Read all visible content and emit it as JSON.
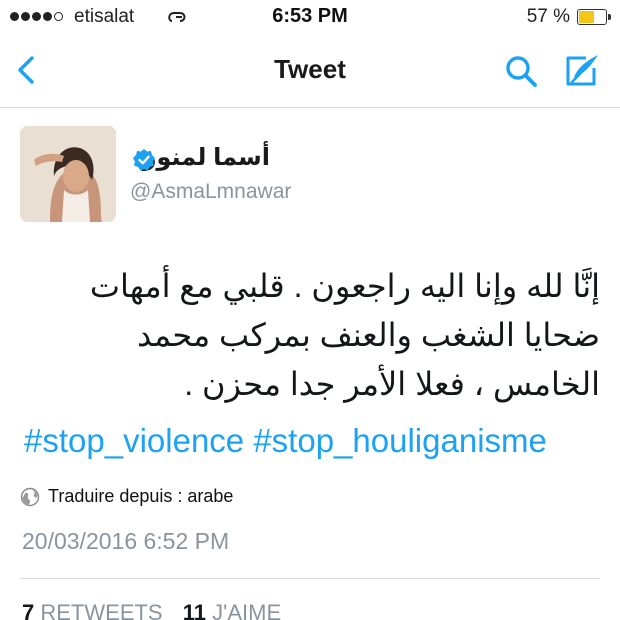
{
  "status_bar": {
    "carrier": "etisalat",
    "time": "6:53 PM",
    "battery_percent": "57 %",
    "battery_level": 0.57,
    "signal_bars": 4
  },
  "nav": {
    "title": "Tweet",
    "accent_color": "#1da1f2"
  },
  "tweet": {
    "author_name": "أسما لمنور",
    "author_handle": "@AsmaLmnawar",
    "verified": true,
    "text_lines": [
      "إنَّا لله وإنا اليه راجعون . قلبي مع أمهات",
      "ضحايا الشغب والعنف بمركب محمد",
      "الخامس ، فعلا الأمر جدا محزن ."
    ],
    "hashtags": [
      "#stop_violence",
      "#stop_houliganisme"
    ],
    "translate_label": "Traduire depuis : arabe",
    "timestamp": "20/03/2016 6:52 PM",
    "retweets_count": "7",
    "retweets_label": "RETWEETS",
    "likes_count": "11",
    "likes_label": "J'AIME"
  }
}
